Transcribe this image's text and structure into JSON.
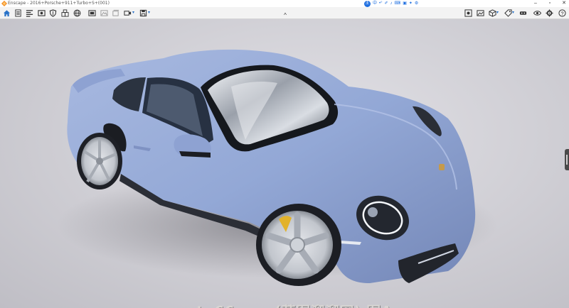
{
  "window": {
    "title": "Enscape - 2016+Porsche+911+Turbo+S+(001)",
    "controls": {
      "minimize": "–",
      "maximize": "▫",
      "close": "✕"
    }
  },
  "ime_bar": {
    "badge": "王",
    "items": [
      "中",
      "•°",
      "✐",
      "♪",
      "⌨",
      "▣",
      "✦",
      "⚙"
    ]
  },
  "toolbar": {
    "collapse_glyph": "^",
    "dropdown_glyph": "▾"
  },
  "viewport": {
    "scene": "Porsche 911 Turbo S rendering"
  },
  "watermark": {
    "text": "www.caotu66.com(草图溜溜网) 图A"
  },
  "colors": {
    "accent": "#2a73c8",
    "car_body": "#93a8d6",
    "background": "#cfced4"
  }
}
